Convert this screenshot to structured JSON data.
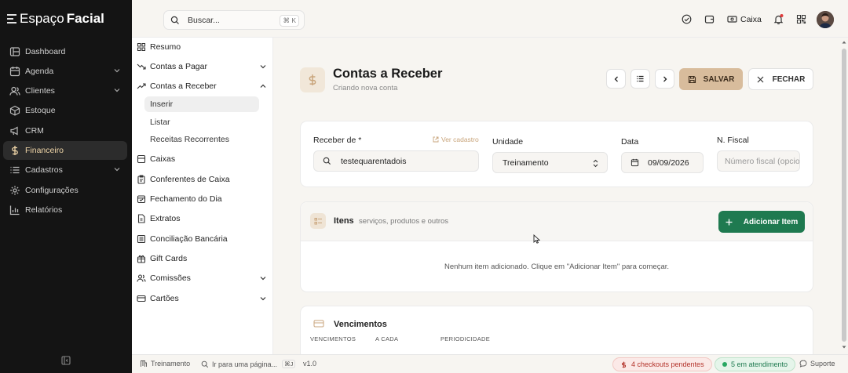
{
  "app": {
    "logo_text": "EspaçoFacial",
    "brand": "Espaço",
    "brand2": "Facial"
  },
  "sidebar": {
    "items": [
      {
        "label": "Dashboard",
        "icon": "dashboard-icon"
      },
      {
        "label": "Agenda",
        "icon": "calendar-icon",
        "expandable": true
      },
      {
        "label": "Clientes",
        "icon": "users-icon",
        "expandable": true
      },
      {
        "label": "Estoque",
        "icon": "box-icon"
      },
      {
        "label": "CRM",
        "icon": "megaphone-icon"
      },
      {
        "label": "Financeiro",
        "icon": "dollar-icon",
        "active": true
      },
      {
        "label": "Cadastros",
        "icon": "list-icon",
        "expandable": true
      },
      {
        "label": "Configurações",
        "icon": "gear-icon"
      },
      {
        "label": "Relatórios",
        "icon": "chart-icon"
      }
    ]
  },
  "submenu": {
    "items": [
      {
        "label": "Resumo",
        "icon": "grid-icon"
      },
      {
        "label": "Contas a Pagar",
        "icon": "trend-down-icon",
        "chevron": "down"
      },
      {
        "label": "Contas a Receber",
        "icon": "trend-up-icon",
        "chevron": "up"
      },
      {
        "label": "Caixas",
        "icon": "cash-register-icon"
      },
      {
        "label": "Conferentes de Caixa",
        "icon": "clipboard-icon"
      },
      {
        "label": "Fechamento do Dia",
        "icon": "calendar-check-icon"
      },
      {
        "label": "Extratos",
        "icon": "file-icon"
      },
      {
        "label": "Conciliação Bancária",
        "icon": "bank-icon"
      },
      {
        "label": "Gift Cards",
        "icon": "gift-icon"
      },
      {
        "label": "Comissões",
        "icon": "users-icon",
        "chevron": "down"
      },
      {
        "label": "Cartões",
        "icon": "card-icon",
        "chevron": "down"
      }
    ],
    "subitems": [
      {
        "label": "Inserir",
        "current": true
      },
      {
        "label": "Listar"
      },
      {
        "label": "Receitas Recorrentes"
      }
    ]
  },
  "topbar": {
    "search_placeholder": "Buscar...",
    "search_shortcut": "⌘ K",
    "caixa_label": "Caixa"
  },
  "page": {
    "title": "Contas a Receber",
    "subtitle": "Criando nova conta",
    "save_label": "SALVAR",
    "close_label": "FECHAR"
  },
  "form": {
    "receber_label": "Receber de *",
    "ver_cadastro": "Ver cadastro",
    "receber_value": "testequarentadois",
    "unidade_label": "Unidade",
    "unidade_value": "Treinamento",
    "data_label": "Data",
    "data_value": "09/09/2026",
    "fiscal_label": "N. Fiscal",
    "fiscal_placeholder": "Número fiscal (opcional)"
  },
  "items_card": {
    "title": "Itens",
    "subtitle": "serviços, produtos e outros",
    "add_label": "Adicionar Item",
    "empty_text": "Nenhum item adicionado. Clique em \"Adicionar Item\" para começar."
  },
  "due_card": {
    "title": "Vencimentos",
    "columns": [
      "VENCIMENTOS",
      "A CADA",
      "PERIODICIDADE"
    ]
  },
  "bottombar": {
    "unit": "Treinamento",
    "goto": "Ir para uma página...",
    "goto_shortcut": "⌘J",
    "version": "v1.0",
    "checkouts": "4 checkouts pendentes",
    "atendimento": "5 em atendimento",
    "suporte": "Suporte"
  },
  "colors": {
    "accent": "#d8bc9c",
    "success": "#1f7a50",
    "sidebar": "#141414",
    "active_text": "#f0d6a8"
  }
}
